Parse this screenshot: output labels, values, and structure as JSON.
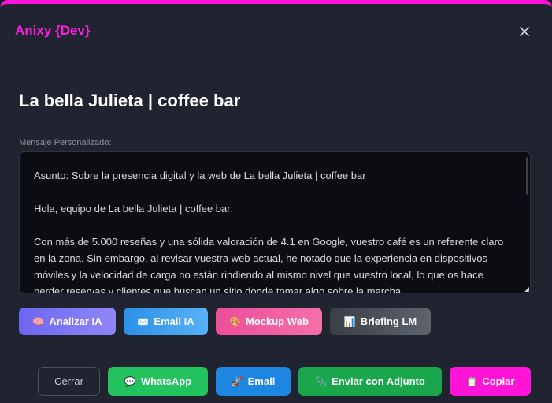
{
  "header": {
    "brand": "Anixy {Dev}",
    "close_icon": "close-icon"
  },
  "title": "La bella Julieta | coffee bar",
  "message": {
    "label": "Mensaje Personalizado:",
    "text": "Asunto: Sobre la presencia digital y la web de La bella Julieta | coffee bar\n\nHola, equipo de La bella Julieta | coffee bar:\n\nCon más de 5.000 reseñas y una sólida valoración de 4.1 en Google, vuestro café es un referente claro en la zona. Sin embargo, al revisar vuestra web actual, he notado que la experiencia en dispositivos móviles y la velocidad de carga no están rindiendo al mismo nivel que vuestro local, lo que os hace perder reservas y clientes que buscan un sitio donde tomar algo sobre la marcha."
  },
  "ai_actions": [
    {
      "icon": "🧠",
      "label": "Analizar IA"
    },
    {
      "icon": "✉️",
      "label": "Email IA"
    },
    {
      "icon": "🎨",
      "label": "Mockup Web"
    },
    {
      "icon": "📊",
      "label": "Briefing LM"
    }
  ],
  "footer_actions": [
    {
      "icon": "",
      "label": "Cerrar"
    },
    {
      "icon": "💬",
      "label": "WhatsApp"
    },
    {
      "icon": "🚀",
      "label": "Email"
    },
    {
      "icon": "📎",
      "label": "Enviar con Adjunto"
    },
    {
      "icon": "📋",
      "label": "Copiar"
    }
  ],
  "colors": {
    "accent": "#ff14d8",
    "background": "#1f2430",
    "whatsapp": "#22c35e",
    "email": "#1d86e0"
  }
}
